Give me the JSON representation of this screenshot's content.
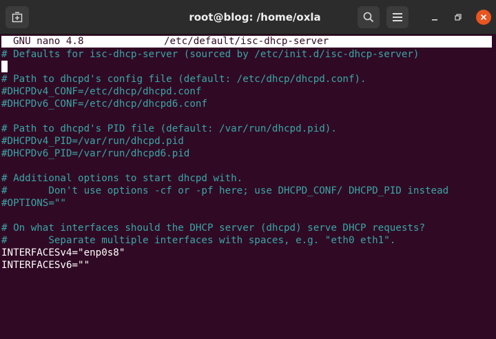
{
  "window": {
    "title": "root@blog: /home/oxla",
    "icons": {
      "new_tab": "new-tab-icon",
      "search": "search-icon",
      "menu": "hamburger-menu-icon",
      "minimize": "minimize-icon",
      "maximize": "maximize-icon",
      "close": "close-icon"
    },
    "colors": {
      "titlebar": "#2c2c2c",
      "close_button": "#e95420"
    }
  },
  "nano": {
    "version": "GNU nano 4.8",
    "filename": "/etc/default/isc-dhcp-server"
  },
  "terminal": {
    "colors": {
      "background": "#300a24",
      "comment": "#3aa6a8",
      "text": "#ffffff"
    },
    "lines": [
      "# Defaults for isc-dhcp-server (sourced by /etc/init.d/isc-dhcp-server)",
      "",
      "# Path to dhcpd's config file (default: /etc/dhcp/dhcpd.conf).",
      "#DHCPDv4_CONF=/etc/dhcp/dhcpd.conf",
      "#DHCPDv6_CONF=/etc/dhcp/dhcpd6.conf",
      "",
      "# Path to dhcpd's PID file (default: /var/run/dhcpd.pid).",
      "#DHCPDv4_PID=/var/run/dhcpd.pid",
      "#DHCPDv6_PID=/var/run/dhcpd6.pid",
      "",
      "# Additional options to start dhcpd with.",
      "#       Don't use options -cf or -pf here; use DHCPD_CONF/ DHCPD_PID instead",
      "#OPTIONS=\"\"",
      "",
      "# On what interfaces should the DHCP server (dhcpd) serve DHCP requests?",
      "#       Separate multiple interfaces with spaces, e.g. \"eth0 eth1\".",
      "INTERFACESv4=\"enp0s8\"",
      "INTERFACESv6=\"\""
    ]
  }
}
